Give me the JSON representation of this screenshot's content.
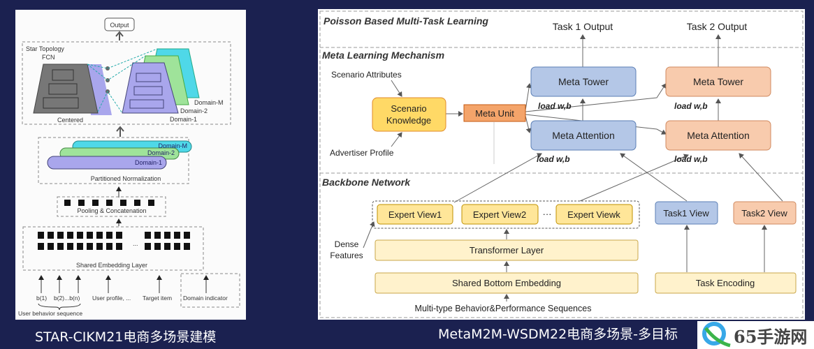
{
  "left": {
    "output": "Output",
    "star_topology": "Star Topology",
    "fcn": "FCN",
    "centered": "Centered",
    "domain_m": "Domain-M",
    "domain_2": "Domain-2",
    "domain_1": "Domain-1",
    "partitioned_normalization": "Partitioned Normalization",
    "pooling": "Pooling & Concatenation",
    "shared_embedding": "Shared Embedding Layer",
    "ellipsis": "...",
    "inputs": [
      "b(1)",
      "b(2)...b(n)",
      "User profile, ...",
      "Target item",
      "Domain indicator"
    ],
    "user_behavior_sequence": "User behavior sequence",
    "caption": "STAR-CIKM21电商多场景建模"
  },
  "right": {
    "title": "Poisson Based Multi-Task Learning",
    "task1_output": "Task 1 Output",
    "task2_output": "Task 2 Output",
    "meta_section": "Meta Learning Mechanism",
    "scenario_attributes": "Scenario Attributes",
    "advertiser_profile": "Advertiser Profile",
    "scenario_knowledge": [
      "Scenario",
      "Knowledge"
    ],
    "meta_unit": "Meta Unit",
    "meta_tower": "Meta Tower",
    "meta_attention": "Meta Attention",
    "load_wb": "load w,b",
    "backbone_section": "Backbone Network",
    "expert_views": [
      "Expert View1",
      "Expert View2",
      "Expert Viewk"
    ],
    "ellipsis": "···",
    "task1_view": "Task1 View",
    "task2_view": "Task2 View",
    "dense_features": [
      "Dense",
      "Features"
    ],
    "transformer_layer": "Transformer Layer",
    "shared_bottom": "Shared Bottom Embedding",
    "task_encoding": "Task Encoding",
    "sequences": "Multi-type Behavior&Performance Sequences",
    "caption": "MetaM2M-WSDM22电商多场景-多目标"
  },
  "watermark": {
    "text": "65手游网",
    "icon": "leaf-q-logo-icon"
  },
  "colors": {
    "background": "#1b2150",
    "blue_box": "#b4c7e7",
    "peach_box": "#f8cbad",
    "yellow_box": "#ffe699",
    "orange_box": "#f4b183",
    "light_yellow": "#fff2cc"
  }
}
